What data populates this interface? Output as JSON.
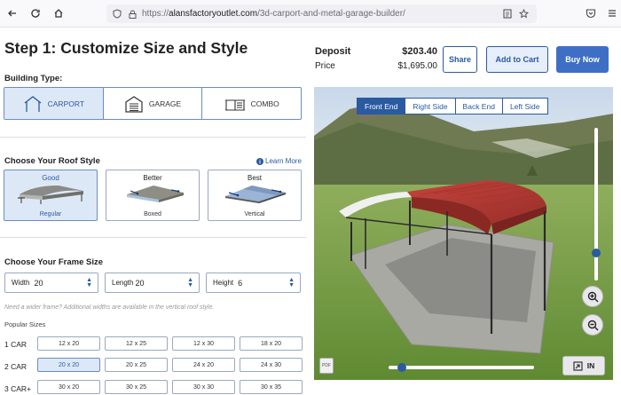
{
  "browser": {
    "url_prefix": "https://",
    "url_host": "alansfactoryoutlet.com",
    "url_path": "/3d-carport-and-metal-garage-builder/"
  },
  "left": {
    "title": "Step 1: Customize Size and Style",
    "building_type_label": "Building Type:",
    "building_types": [
      {
        "label": "CARPORT",
        "icon": "carport-icon",
        "active": true
      },
      {
        "label": "GARAGE",
        "icon": "garage-icon",
        "active": false
      },
      {
        "label": "COMBO",
        "icon": "combo-icon",
        "active": false
      }
    ],
    "roof_label": "Choose Your Roof Style",
    "learn_more": "Learn More",
    "roofs": [
      {
        "tier": "Good",
        "name": "Regular",
        "active": true
      },
      {
        "tier": "Better",
        "name": "Boxed",
        "active": false
      },
      {
        "tier": "Best",
        "name": "Vertical",
        "active": false
      }
    ],
    "frame_label": "Choose Your Frame Size",
    "selects": [
      {
        "label": "Width",
        "value": "20"
      },
      {
        "label": "Length",
        "value": "20"
      },
      {
        "label": "Height",
        "value": "6"
      }
    ],
    "note": "Need a wider frame? Additional widths are available in the vertical roof style.",
    "popular_label": "Popular Sizes",
    "size_rows": [
      {
        "label": "1 CAR",
        "sizes": [
          "12 x 20",
          "12 x 25",
          "12 x 30",
          "18 x 20"
        ]
      },
      {
        "label": "2 CAR",
        "sizes": [
          "20 x 20",
          "20 x 25",
          "24 x 20",
          "24 x 30"
        ]
      },
      {
        "label": "3 CAR+",
        "sizes": [
          "30 x 20",
          "30 x 25",
          "30 x 30",
          "30 x 35"
        ]
      }
    ],
    "active_size": "20 x 20"
  },
  "right": {
    "deposit_label": "Deposit",
    "deposit_value": "$203.40",
    "price_label": "Price",
    "price_value": "$1,695.00",
    "share": "Share",
    "add_to_cart": "Add to Cart",
    "buy_now": "Buy Now",
    "view_tabs": [
      "Front End",
      "Right Side",
      "Back End",
      "Left Side"
    ],
    "active_view": "Front End",
    "in_label": "IN",
    "pdf_label": "PDF"
  },
  "colors": {
    "accent": "#2a5aa0",
    "buy_now": "#3e6fc4",
    "roof_red": "#b03a35",
    "active_bg": "#dde8f7"
  }
}
